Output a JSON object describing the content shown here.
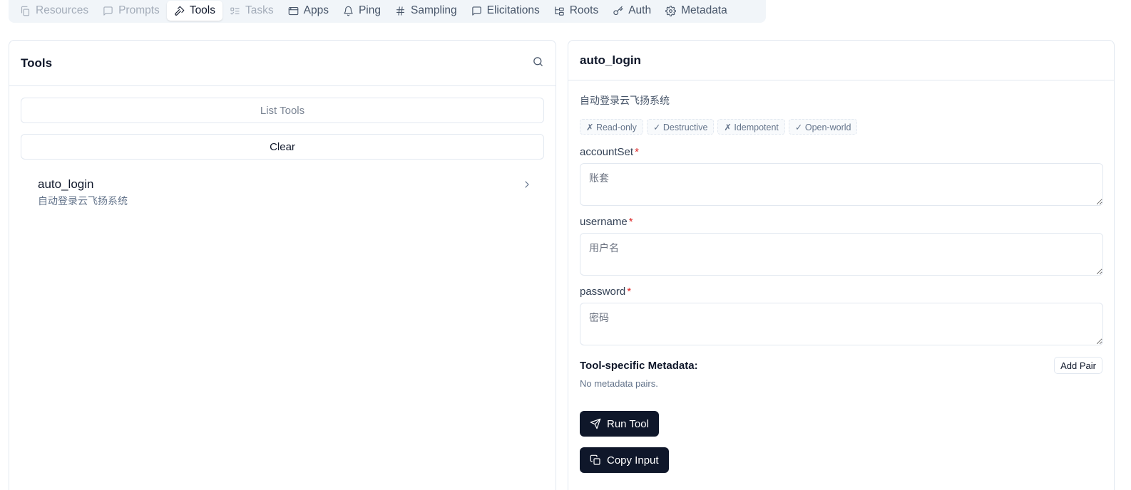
{
  "tabs": [
    {
      "label": "Resources",
      "icon": "files-icon",
      "state": "disabled"
    },
    {
      "label": "Prompts",
      "icon": "message-square-icon",
      "state": "disabled"
    },
    {
      "label": "Tools",
      "icon": "hammer-icon",
      "state": "active"
    },
    {
      "label": "Tasks",
      "icon": "list-todo-icon",
      "state": "disabled"
    },
    {
      "label": "Apps",
      "icon": "app-window-icon",
      "state": "normal"
    },
    {
      "label": "Ping",
      "icon": "bell-icon",
      "state": "normal"
    },
    {
      "label": "Sampling",
      "icon": "hash-icon",
      "state": "normal"
    },
    {
      "label": "Elicitations",
      "icon": "message-square-icon",
      "state": "normal"
    },
    {
      "label": "Roots",
      "icon": "folder-tree-icon",
      "state": "normal"
    },
    {
      "label": "Auth",
      "icon": "key-icon",
      "state": "normal"
    },
    {
      "label": "Metadata",
      "icon": "settings-icon",
      "state": "normal"
    }
  ],
  "tools_panel": {
    "title": "Tools",
    "list_button": "List Tools",
    "clear_button": "Clear",
    "items": [
      {
        "name": "auto_login",
        "description": "自动登录云飞扬系统"
      }
    ]
  },
  "detail_panel": {
    "title": "auto_login",
    "description": "自动登录云飞扬系统",
    "badges": [
      "✗ Read-only",
      "✓ Destructive",
      "✗ Idempotent",
      "✓ Open-world"
    ],
    "required_mark": "*",
    "fields": [
      {
        "label": "accountSet",
        "placeholder": "账套"
      },
      {
        "label": "username",
        "placeholder": "用户名"
      },
      {
        "label": "password",
        "placeholder": "密码"
      }
    ],
    "metadata_title": "Tool-specific Metadata:",
    "add_pair_button": "Add Pair",
    "metadata_empty": "No metadata pairs.",
    "run_button": "Run Tool",
    "copy_button": "Copy Input"
  },
  "colors": {
    "primary_dark": "#0f172a",
    "border": "#e2e8f0",
    "tabbar_bg": "#f1f5f9",
    "required": "#dc2626",
    "muted": "#64748b"
  }
}
